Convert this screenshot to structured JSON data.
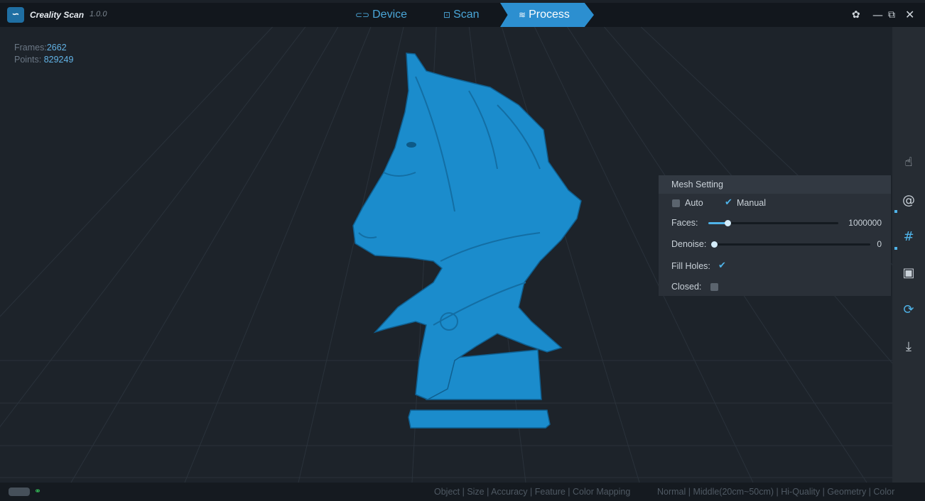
{
  "titlebar": {
    "logo_glyph": "∽",
    "app_name": "Creality Scan",
    "version": "1.0.0",
    "tabs": [
      {
        "label": "Device",
        "icon": "device-icon",
        "glyph": "⊂⊃"
      },
      {
        "label": "Scan",
        "icon": "scan-icon",
        "glyph": "⊡"
      },
      {
        "label": "Process",
        "icon": "layers-icon",
        "glyph": "≋",
        "active": true
      }
    ],
    "window_glyphs": {
      "settings": "✿",
      "minimize": "—",
      "restore": "⧉",
      "close": "✕"
    }
  },
  "stats": {
    "frames_label": "Frames:",
    "frames_value": "2662",
    "points_label": "Points:",
    "points_value": "829249"
  },
  "model": {
    "color": "#1b8ccc"
  },
  "tools": [
    {
      "icon": "hand-pointer-icon",
      "glyph": "☝"
    },
    {
      "icon": "lasso-icon",
      "glyph": "@"
    },
    {
      "icon": "mesh-grid-icon",
      "glyph": "#",
      "active": true
    },
    {
      "icon": "texture-image-icon",
      "glyph": "▣"
    },
    {
      "icon": "refresh-icon",
      "glyph": "⟳"
    },
    {
      "icon": "download-icon",
      "glyph": "⤓"
    }
  ],
  "mesh_setting": {
    "title": "Mesh Setting",
    "auto_label": "Auto",
    "auto_checked": false,
    "manual_label": "Manual",
    "manual_checked": true,
    "faces_label": "Faces:",
    "faces_value": "1000000",
    "faces_level": 0.15,
    "denoise_label": "Denoise:",
    "denoise_value": "0",
    "denoise_level": 0.0,
    "fill_holes_label": "Fill Holes:",
    "fill_holes_checked": true,
    "closed_label": "Closed:",
    "closed_checked": false
  },
  "statusbar": {
    "link_glyph": "⚭",
    "scan_params_labels": "Object | Size | Accuracy | Feature | Color Mapping",
    "scan_params_values": "Normal | Middle(20cm~50cm) | Hi-Quality | Geometry | Color"
  },
  "colors": {
    "accent": "#2c8fd0",
    "link_ok": "#36c25a"
  }
}
